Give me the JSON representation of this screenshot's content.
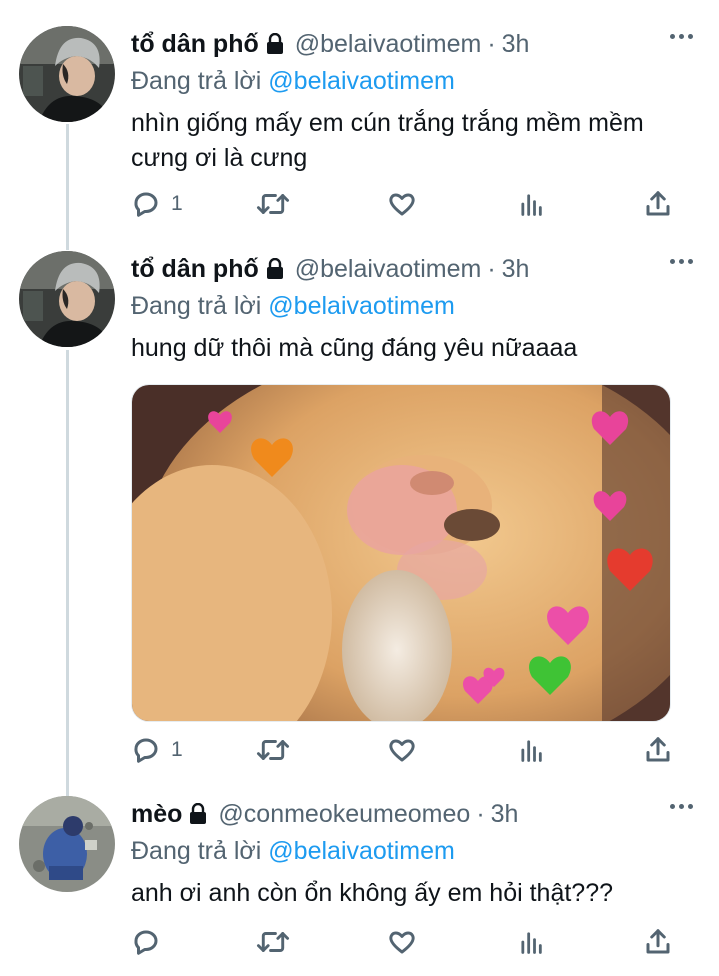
{
  "tweets": [
    {
      "name": "tổ dân phố",
      "handle": "@belaivaotimem",
      "dot": "·",
      "time": "3h",
      "reply_prefix": "Đang trả lời",
      "reply_to": "@belaivaotimem",
      "text": "nhìn giống mấy em cún trắng trắng mềm mềm cưng ơi là cưng",
      "reply_count": "1"
    },
    {
      "name": "tổ dân phố",
      "handle": "@belaivaotimem",
      "dot": "·",
      "time": "3h",
      "reply_prefix": "Đang trả lời",
      "reply_to": "@belaivaotimem",
      "text": "hung dữ thôi mà cũng đáng yêu nữaaaa",
      "reply_count": "1"
    },
    {
      "name": "mèo",
      "handle": "@conmeokeumeomeo",
      "dot": "·",
      "time": "3h",
      "reply_prefix": "Đang trả lời",
      "reply_to": "@belaivaotimem",
      "text": "anh ơi anh còn ổn không ấy em hỏi thật???",
      "reply_count": ""
    }
  ],
  "icons": {
    "lock": "lock-icon",
    "more": "more-dots-icon",
    "reply": "reply-icon",
    "retweet": "retweet-icon",
    "like": "heart-icon",
    "views": "analytics-icon",
    "share": "share-icon"
  },
  "colors": {
    "accent": "#1d9bf0",
    "muted": "#536471",
    "thread_line": "#cfd9de"
  }
}
